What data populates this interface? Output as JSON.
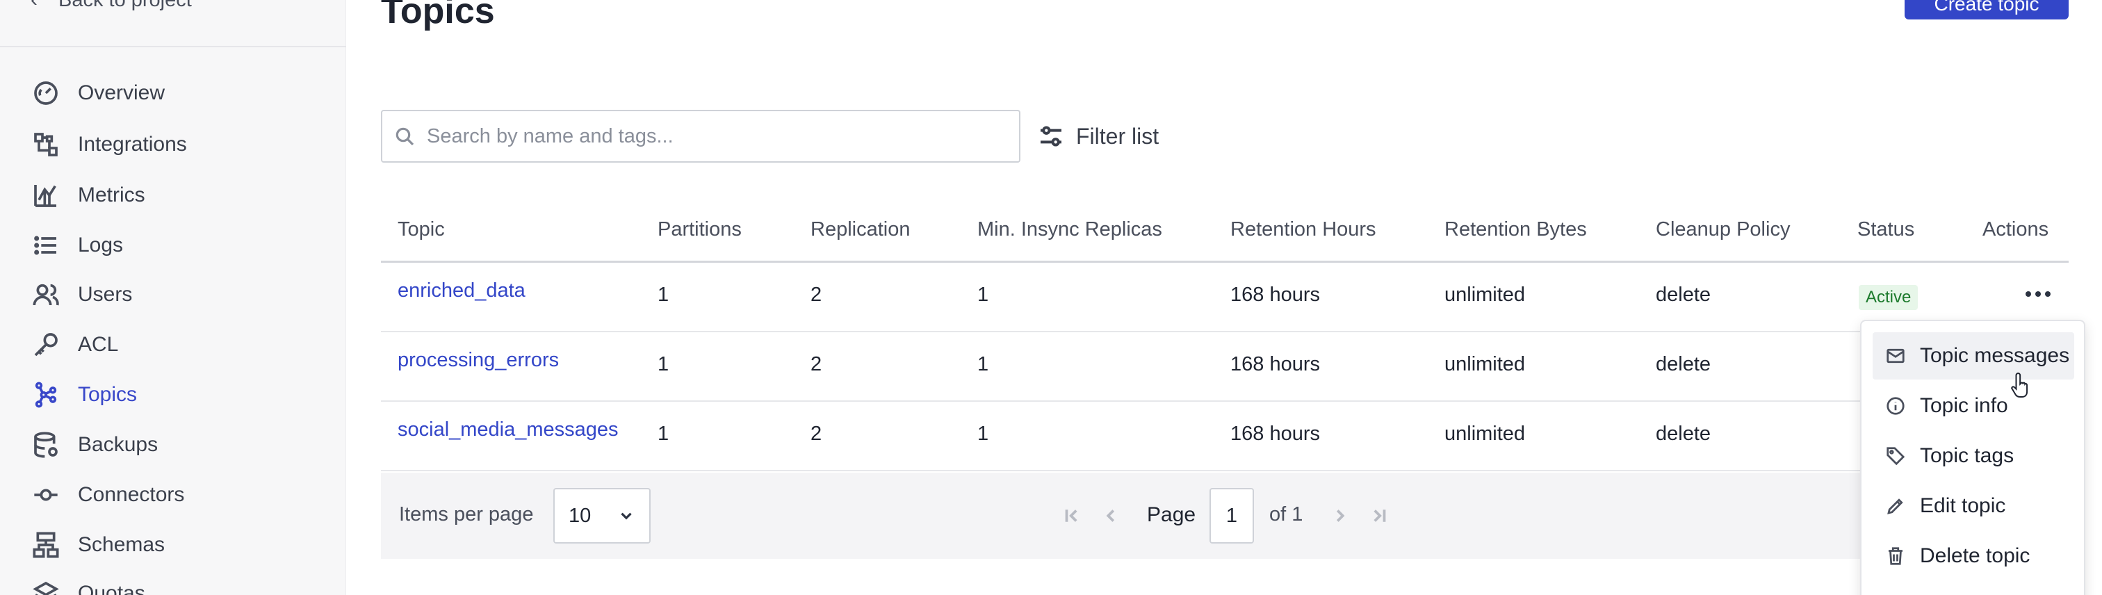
{
  "sidebar": {
    "back_label": "Back to project",
    "items": [
      {
        "label": "Overview",
        "icon": "gauge-icon"
      },
      {
        "label": "Integrations",
        "icon": "integrations-icon"
      },
      {
        "label": "Metrics",
        "icon": "metrics-icon"
      },
      {
        "label": "Logs",
        "icon": "logs-icon"
      },
      {
        "label": "Users",
        "icon": "users-icon"
      },
      {
        "label": "ACL",
        "icon": "key-icon"
      },
      {
        "label": "Topics",
        "icon": "topics-icon",
        "active": true
      },
      {
        "label": "Backups",
        "icon": "database-icon"
      },
      {
        "label": "Connectors",
        "icon": "connector-icon"
      },
      {
        "label": "Schemas",
        "icon": "schema-icon"
      },
      {
        "label": "Quotas",
        "icon": "layers-icon"
      }
    ]
  },
  "header": {
    "title": "Topics",
    "button_label": "Create topic"
  },
  "search": {
    "placeholder": "Search by name and tags...",
    "value": ""
  },
  "filter": {
    "label": "Filter list"
  },
  "table": {
    "columns": [
      "Topic",
      "Partitions",
      "Replication",
      "Min. Insync Replicas",
      "Retention Hours",
      "Retention Bytes",
      "Cleanup Policy",
      "Status",
      "Actions"
    ],
    "rows": [
      {
        "topic": "enriched_data",
        "partitions": "1",
        "replication": "2",
        "min_insync": "1",
        "retention_hours": "168 hours",
        "retention_bytes": "unlimited",
        "cleanup": "delete",
        "status": "Active"
      },
      {
        "topic": "processing_errors",
        "partitions": "1",
        "replication": "2",
        "min_insync": "1",
        "retention_hours": "168 hours",
        "retention_bytes": "unlimited",
        "cleanup": "delete",
        "status": ""
      },
      {
        "topic": "social_media_messages",
        "partitions": "1",
        "replication": "2",
        "min_insync": "1",
        "retention_hours": "168 hours",
        "retention_bytes": "unlimited",
        "cleanup": "delete",
        "status": ""
      }
    ]
  },
  "pagination": {
    "items_per_page_label": "Items per page",
    "items_per_page_value": "10",
    "page_label": "Page",
    "current_page": "1",
    "of_total": "of 1"
  },
  "actions_menu": {
    "items": [
      {
        "label": "Topic messages",
        "icon": "mail-icon"
      },
      {
        "label": "Topic info",
        "icon": "info-icon"
      },
      {
        "label": "Topic tags",
        "icon": "tag-icon"
      },
      {
        "label": "Edit topic",
        "icon": "pencil-icon"
      },
      {
        "label": "Delete topic",
        "icon": "trash-icon"
      }
    ]
  },
  "colors": {
    "accent": "#3346c8",
    "active_nav": "#3847c9",
    "status_active_bg": "#e7f6e9",
    "status_active_text": "#1c7a2c"
  }
}
